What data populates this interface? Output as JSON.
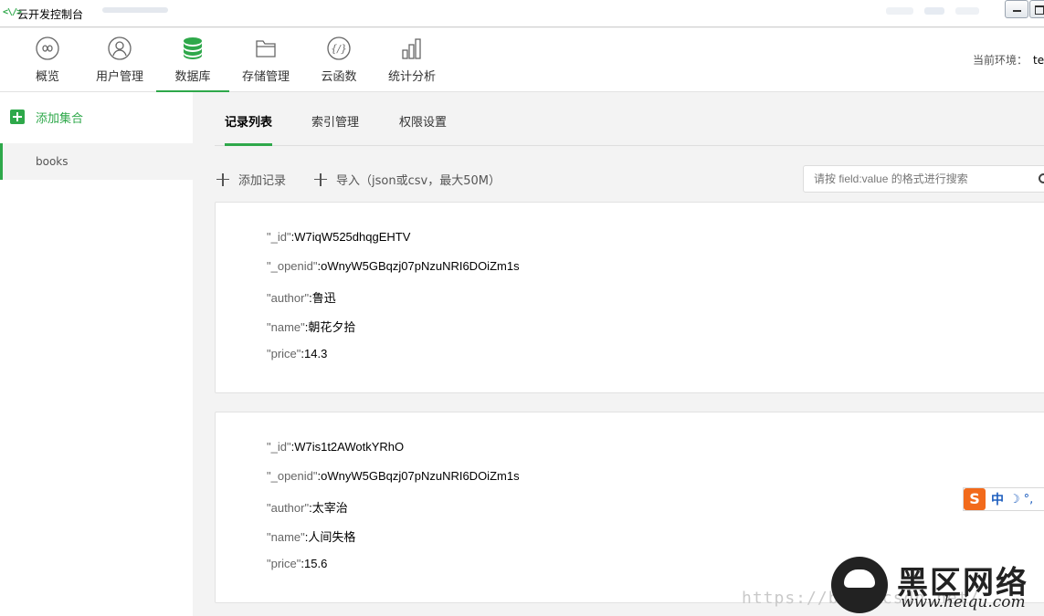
{
  "window": {
    "logo": "<\\/>",
    "title": "云开发控制台"
  },
  "nav": {
    "items": [
      {
        "label": "概览",
        "icon": "infinity-icon"
      },
      {
        "label": "用户管理",
        "icon": "user-icon"
      },
      {
        "label": "数据库",
        "icon": "database-icon"
      },
      {
        "label": "存储管理",
        "icon": "folder-icon"
      },
      {
        "label": "云函数",
        "icon": "function-icon"
      },
      {
        "label": "统计分析",
        "icon": "bar-chart-icon"
      }
    ],
    "active_index": 2,
    "env_label": "当前环境：",
    "env_value": "te"
  },
  "sidebar": {
    "add_collection": "添加集合",
    "collections": [
      "books"
    ]
  },
  "main": {
    "tabs": [
      "记录列表",
      "索引管理",
      "权限设置"
    ],
    "add_record": "添加记录",
    "import": "导入（json或csv，最大50M）",
    "search_placeholder": "请按 field:value 的格式进行搜索",
    "records": [
      {
        "fields": [
          {
            "key": "\"_id\"",
            "value": "W7iqW525dhqgEHTV"
          },
          {
            "key": "\"_openid\"",
            "value": "oWnyW5GBqzj07pNzuNRI6DOiZm1s"
          },
          {
            "key": "\"author\"",
            "value": "鲁迅"
          },
          {
            "key": "\"name\"",
            "value": "朝花夕拾"
          },
          {
            "key": "\"price\"",
            "value": "14.3"
          }
        ]
      },
      {
        "fields": [
          {
            "key": "\"_id\"",
            "value": "W7is1t2AWotkYRhO"
          },
          {
            "key": "\"_openid\"",
            "value": "oWnyW5GBqzj07pNzuNRI6DOiZm1s"
          },
          {
            "key": "\"author\"",
            "value": "太宰治"
          },
          {
            "key": "\"name\"",
            "value": "人间失格"
          },
          {
            "key": "\"price\"",
            "value": "15.6"
          }
        ]
      }
    ]
  },
  "ime": {
    "s": "S",
    "mode": "中"
  },
  "watermark": {
    "url": "https://blog.csdn.net/",
    "brand": "黑区网络",
    "site": "www.heiqu.com"
  },
  "colors": {
    "accent": "#2ea84a",
    "ime": "#f26a1b"
  }
}
